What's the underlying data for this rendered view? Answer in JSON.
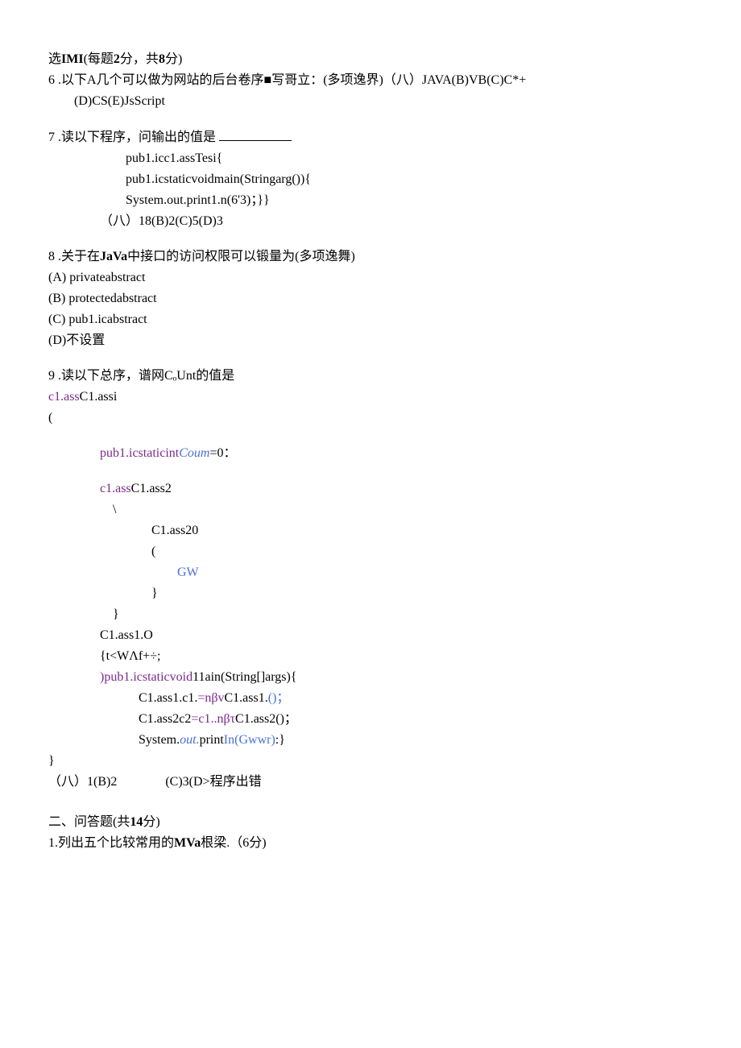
{
  "header": {
    "title_prefix": "选",
    "title_bold": "IMI",
    "title_suffix": "(每题",
    "title_points1": "2",
    "title_mid": "分，共",
    "title_points2": "8",
    "title_end": "分)"
  },
  "q6": {
    "num": "6",
    "dot": " .",
    "text_a": "以下A几个可以做为网站的后台卷序■写哥立：(多项逸界)（八）JAVA(B)VB(C)C*+",
    "text_b": "(D)CS(E)JsScript"
  },
  "q7": {
    "num": "7",
    "dot": " .",
    "text": "读以下程序，问输出的值是 ",
    "code1": "pub1.icc1.assTesi{",
    "code2": "pub1.icstaticvoidmain(Stringarg()){",
    "code3": "System.out.print1.n(6'3)；}}",
    "ans": "（八）18(B)2(C)5(D)3"
  },
  "q8": {
    "num": "8",
    "dot": " .",
    "text_a": "关于在",
    "bold": "JaVa",
    "text_b": "中接口的访问权限可以锻量为(多项逸舞)",
    "optA": "(A)    privateabstract",
    "optB": "(B)    protectedabstract",
    "optC": "(C)    pub1.icabstract",
    "optD": "(D)不设置"
  },
  "q9": {
    "num": "9",
    "dot": " .",
    "text": "读以下总序，谱网CₒUnt的值是",
    "l1a": "c1.ass",
    "l1b": "C1.assi",
    "l2": "(",
    "l3a": "pub1.icstaticint",
    "l3b": "Coum",
    "l3c": "=0：",
    "l4a": "c1.ass",
    "l4b": "C1.ass2",
    "l5": "\\",
    "l6": "C1.ass20",
    "l7": "(",
    "l8": "GW",
    "l9": "}",
    "l10": "}",
    "l11": "C1.ass1.O",
    "l12": " {t<WΛf+÷;",
    "l13a": ")pub1.icstaticvoid",
    "l13b": "11ain(String[]args){",
    "l14a": "C1.ass1.c1.",
    "l14b": "=nβv",
    "l14c": "C1.ass1.",
    "l14d": "()；",
    "l15a": "C1.ass2c2",
    "l15b": "=c1..nβτ",
    "l15c": "C1.ass2()；",
    "l16a": "System.",
    "l16b": "out.",
    "l16c": "print",
    "l16d": "In(Gwwr)",
    "l16e": ":}",
    "l17": "}",
    "ans_a": "（八）1(B)2",
    "ans_b": "(C)3(D>程序出错"
  },
  "section2": {
    "title_a": "二、问答题(共",
    "title_bold": "14",
    "title_b": "分)",
    "q1_a": "1.列出五个比较常用的",
    "q1_bold": "MVa",
    "q1_b": "根梁.（6分)"
  }
}
